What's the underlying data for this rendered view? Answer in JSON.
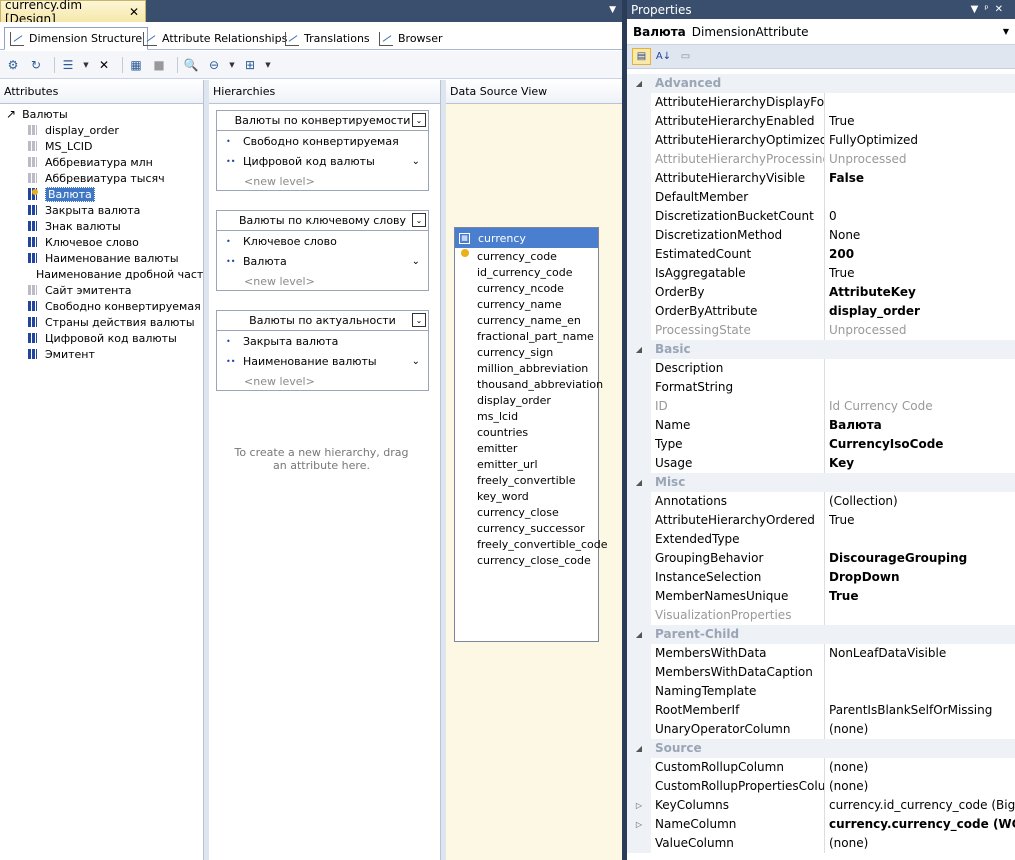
{
  "document_tab": {
    "title": "currency.dim [Design]",
    "close": "✕"
  },
  "designer_tabs": [
    {
      "label": "Dimension Structure"
    },
    {
      "label": "Attribute Relationships"
    },
    {
      "label": "Translations"
    },
    {
      "label": "Browser"
    }
  ],
  "panes": {
    "attributes": "Attributes",
    "hierarchies": "Hierarchies",
    "dsv": "Data Source View"
  },
  "attributes": {
    "root": "Валюты",
    "items": [
      {
        "label": "display_order",
        "icon": "attribute-disabled"
      },
      {
        "label": "MS_LCID",
        "icon": "attribute-disabled"
      },
      {
        "label": "Аббревиатура млн",
        "icon": "attribute-disabled"
      },
      {
        "label": "Аббревиатура тысяч",
        "icon": "attribute-disabled"
      },
      {
        "label": "Валюта",
        "icon": "key-attribute",
        "selected": true
      },
      {
        "label": "Закрыта валюта",
        "icon": "attribute"
      },
      {
        "label": "Знак валюты",
        "icon": "attribute"
      },
      {
        "label": "Ключевое слово",
        "icon": "attribute"
      },
      {
        "label": "Наименование валюты",
        "icon": "attribute"
      },
      {
        "label": "Наименование дробной части",
        "icon": "attribute"
      },
      {
        "label": "Сайт эмитента",
        "icon": "attribute-disabled"
      },
      {
        "label": "Свободно конвертируемая",
        "icon": "attribute"
      },
      {
        "label": "Страны действия валюты",
        "icon": "attribute"
      },
      {
        "label": "Цифровой код валюты",
        "icon": "attribute"
      },
      {
        "label": "Эмитент",
        "icon": "attribute"
      }
    ]
  },
  "hierarchies": [
    {
      "title": "Валюты по конвертируемости",
      "levels": [
        "Свободно конвертируемая",
        "Цифровой код валюты"
      ]
    },
    {
      "title": "Валюты по ключевому слову",
      "levels": [
        "Ключевое слово",
        "Валюта"
      ]
    },
    {
      "title": "Валюты по актуальности",
      "levels": [
        "Закрыта валюта",
        "Наименование валюты"
      ]
    }
  ],
  "new_level": "<new level>",
  "hierarchy_hint": "To create a new hierarchy, drag an attribute here.",
  "dsv_table": {
    "name": "currency",
    "columns": [
      "currency_code",
      "id_currency_code",
      "currency_ncode",
      "currency_name",
      "currency_name_en",
      "fractional_part_name",
      "currency_sign",
      "million_abbreviation",
      "thousand_abbreviation",
      "display_order",
      "ms_lcid",
      "countries",
      "emitter",
      "emitter_url",
      "freely_convertible",
      "key_word",
      "currency_close",
      "currency_successor",
      "freely_convertible_code",
      "currency_close_code"
    ]
  },
  "properties": {
    "title": "Properties",
    "object_name": "Валюта",
    "object_type": "DimensionAttribute",
    "rows": [
      {
        "cat": "Advanced"
      },
      {
        "n": "AttributeHierarchyDisplayFolder",
        "v": ""
      },
      {
        "n": "AttributeHierarchyEnabled",
        "v": "True"
      },
      {
        "n": "AttributeHierarchyOptimizedState",
        "v": "FullyOptimized"
      },
      {
        "n": "AttributeHierarchyProcessingState",
        "v": "Unprocessed",
        "dis": true
      },
      {
        "n": "AttributeHierarchyVisible",
        "v": "False",
        "b": true
      },
      {
        "n": "DefaultMember",
        "v": ""
      },
      {
        "n": "DiscretizationBucketCount",
        "v": "0"
      },
      {
        "n": "DiscretizationMethod",
        "v": "None"
      },
      {
        "n": "EstimatedCount",
        "v": "200",
        "b": true
      },
      {
        "n": "IsAggregatable",
        "v": "True"
      },
      {
        "n": "OrderBy",
        "v": "AttributeKey",
        "b": true
      },
      {
        "n": "OrderByAttribute",
        "v": "display_order",
        "b": true
      },
      {
        "n": "ProcessingState",
        "v": "Unprocessed",
        "dis": true
      },
      {
        "cat": "Basic"
      },
      {
        "n": "Description",
        "v": ""
      },
      {
        "n": "FormatString",
        "v": ""
      },
      {
        "n": "ID",
        "v": "Id Currency Code",
        "dis": true
      },
      {
        "n": "Name",
        "v": "Валюта",
        "b": true
      },
      {
        "n": "Type",
        "v": "CurrencyIsoCode",
        "b": true
      },
      {
        "n": "Usage",
        "v": "Key",
        "b": true
      },
      {
        "cat": "Misc"
      },
      {
        "n": "Annotations",
        "v": "(Collection)"
      },
      {
        "n": "AttributeHierarchyOrdered",
        "v": "True"
      },
      {
        "n": "ExtendedType",
        "v": ""
      },
      {
        "n": "GroupingBehavior",
        "v": "DiscourageGrouping",
        "b": true
      },
      {
        "n": "InstanceSelection",
        "v": "DropDown",
        "b": true
      },
      {
        "n": "MemberNamesUnique",
        "v": "True",
        "b": true
      },
      {
        "n": "VisualizationProperties",
        "v": "",
        "dis": true
      },
      {
        "cat": "Parent-Child"
      },
      {
        "n": "MembersWithData",
        "v": "NonLeafDataVisible"
      },
      {
        "n": "MembersWithDataCaption",
        "v": ""
      },
      {
        "n": "NamingTemplate",
        "v": ""
      },
      {
        "n": "RootMemberIf",
        "v": "ParentIsBlankSelfOrMissing"
      },
      {
        "n": "UnaryOperatorColumn",
        "v": "(none)"
      },
      {
        "cat": "Source"
      },
      {
        "n": "CustomRollupColumn",
        "v": "(none)"
      },
      {
        "n": "CustomRollupPropertiesColumn",
        "v": "(none)"
      },
      {
        "n": "KeyColumns",
        "v": "currency.id_currency_code (BigInt)",
        "exp": true
      },
      {
        "n": "NameColumn",
        "v": "currency.currency_code (WChar)",
        "exp": true,
        "b": true
      },
      {
        "n": "ValueColumn",
        "v": "(none)"
      }
    ]
  }
}
